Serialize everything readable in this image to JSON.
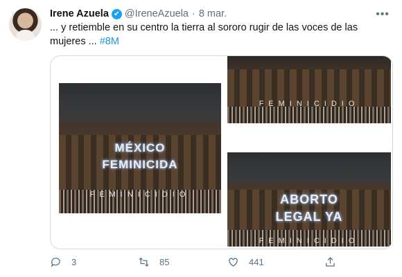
{
  "tweet": {
    "name": "Irene Azuela",
    "handle": "@IreneAzuela",
    "separator": "·",
    "date": "8 mar.",
    "text": "... y retiemble en su centro la tierra al sororo rugir de las voces de las mujeres ...",
    "hashtag": "#8M"
  },
  "media": {
    "photo1": {
      "line1": "MÉXICO",
      "line2": "FEMINICIDA",
      "banner": "FEMINICIDIO"
    },
    "photo2": {
      "banner": "FEMINICIDIO"
    },
    "photo3": {
      "line1": "ABORTO",
      "line2": "LEGAL YA",
      "banner": "FEMINICIDIO"
    }
  },
  "actions": {
    "reply_count": "3",
    "retweet_count": "85",
    "like_count": "441"
  },
  "colors": {
    "accent": "#1da1f2",
    "hashtag": "#1b95e0",
    "muted": "#5b7083"
  },
  "icons": {
    "more": "more-icon",
    "verified": "verified-badge-icon"
  }
}
